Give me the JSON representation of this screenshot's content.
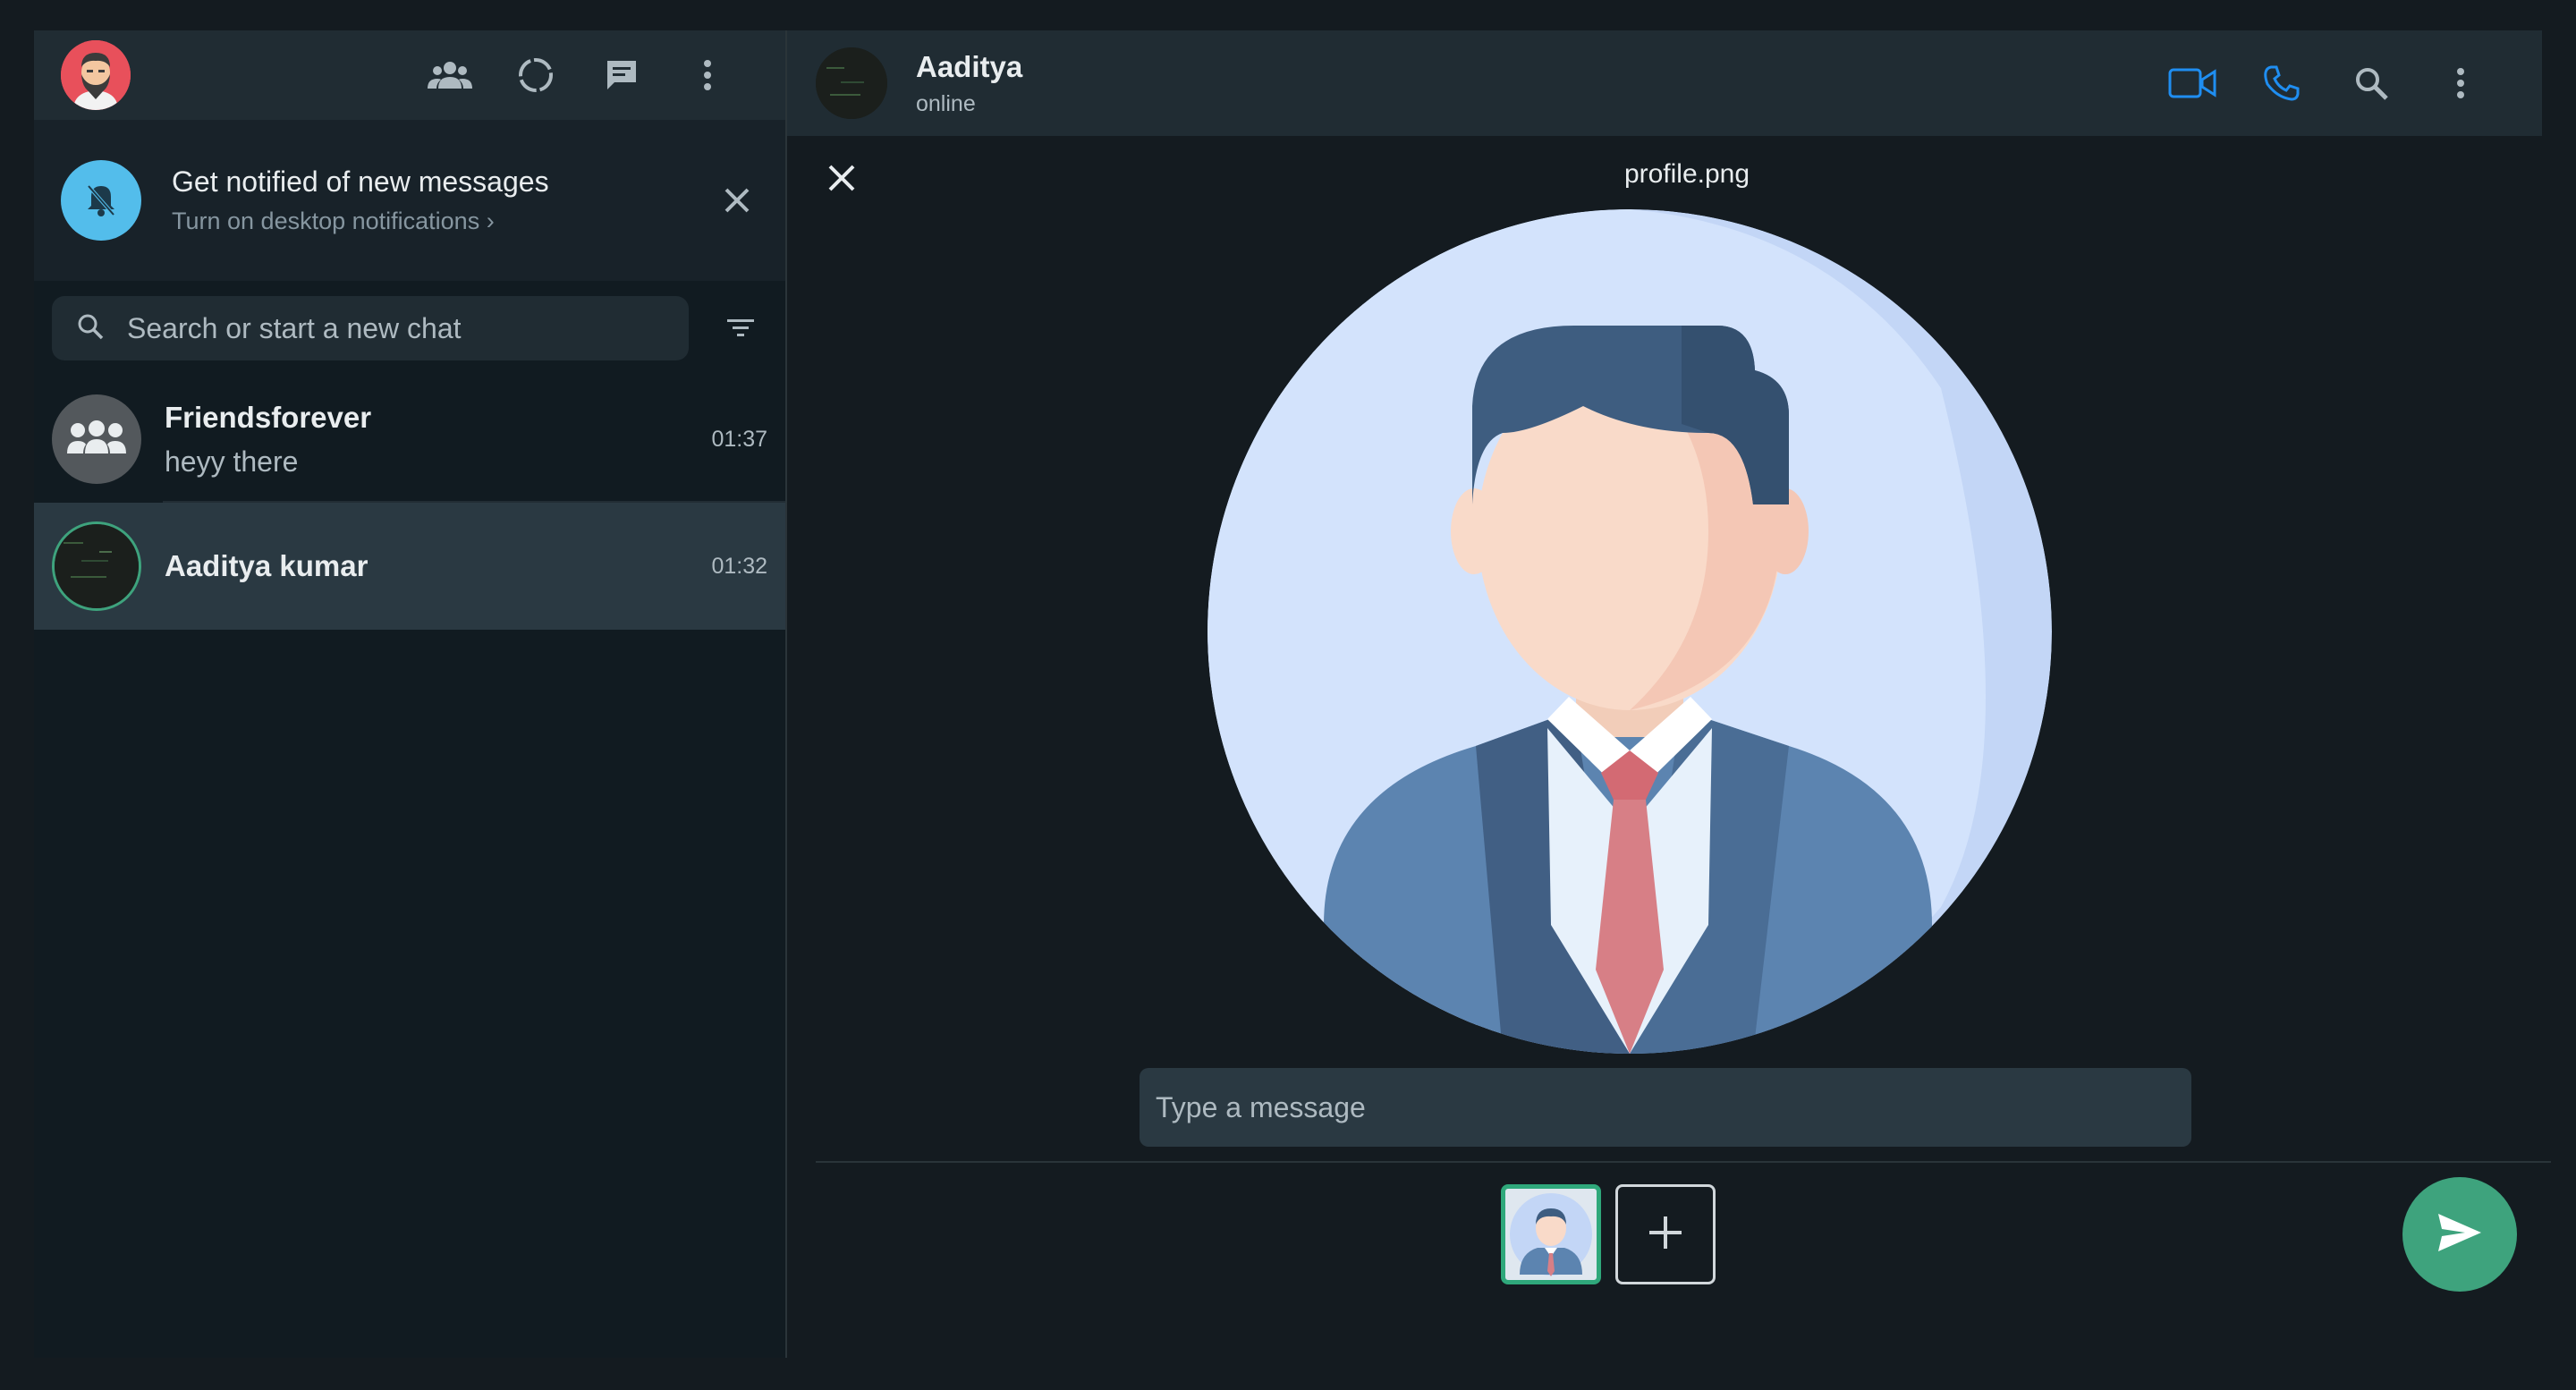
{
  "sidebar": {
    "header_icons": [
      "community-icon",
      "status-icon",
      "new-chat-icon",
      "menu-icon"
    ],
    "notification": {
      "title": "Get notified of new messages",
      "subtitle": "Turn on desktop notifications",
      "chevron": "›"
    },
    "search": {
      "placeholder": "Search or start a new chat"
    },
    "chats": [
      {
        "name": "Friendsforever",
        "last_message": "heyy there",
        "time": "01:37"
      },
      {
        "name": "Aaditya kumar",
        "last_message": "",
        "time": "01:32"
      }
    ]
  },
  "conversation": {
    "contact_name": "Aaditya",
    "contact_status": "online",
    "accent_color": "#1f8ef1"
  },
  "preview": {
    "file_name": "profile.png",
    "caption_placeholder": "Type a message"
  },
  "colors": {
    "panel": "#202c33",
    "background": "#111b21",
    "send": "#3ea37d",
    "notify": "#53bdeb"
  }
}
